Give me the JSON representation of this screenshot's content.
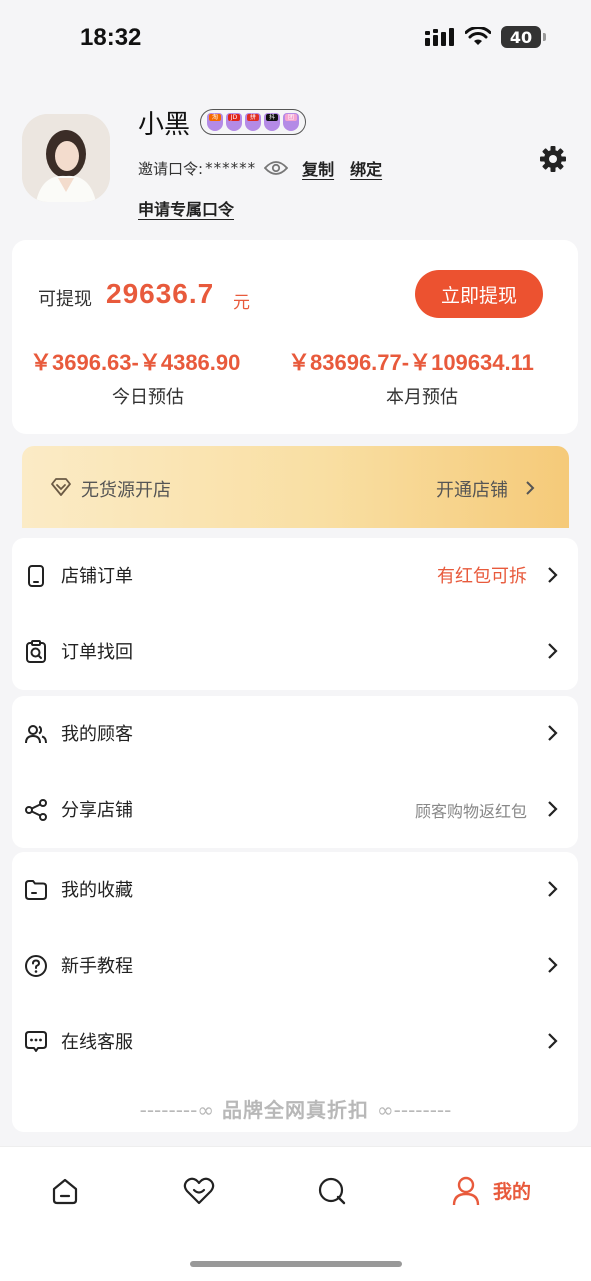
{
  "status": {
    "time": "18:32",
    "battery": "40"
  },
  "profile": {
    "name": "小黑",
    "badges": [
      "淘",
      "JD",
      "拼",
      "抖",
      "团"
    ],
    "invite_label": "邀请口令:",
    "invite_code": "******",
    "copy_label": "复制",
    "bind_label": "绑定",
    "apply_label": "申请专属口令"
  },
  "earnings": {
    "withdraw_label": "可提现",
    "withdraw_amount": "29636.7",
    "withdraw_unit": "元",
    "withdraw_button": "立即提现",
    "today_range": "￥3696.63-￥4386.90",
    "today_label": "今日预估",
    "month_range": "￥83696.77-￥109634.11",
    "month_label": "本月预估"
  },
  "banner": {
    "title": "无货源开店",
    "cta": "开通店铺"
  },
  "menu": [
    {
      "label": "店铺订单",
      "hint": "有红包可拆"
    },
    {
      "label": "订单找回",
      "hint": ""
    },
    {
      "label": "我的顾客",
      "hint": ""
    },
    {
      "label": "分享店铺",
      "hint": "顾客购物返红包"
    },
    {
      "label": "我的收藏",
      "hint": ""
    },
    {
      "label": "新手教程",
      "hint": ""
    },
    {
      "label": "在线客服",
      "hint": ""
    }
  ],
  "footer": {
    "left_deco": "--------∞",
    "text": "品牌全网真折扣",
    "right_deco": "∞--------"
  },
  "tabbar": {
    "me_label": "我的"
  },
  "colors": {
    "accent": "#e85a3c",
    "button": "#ec5230",
    "banner_start": "#fbebc6",
    "banner_end": "#f5ca79"
  }
}
